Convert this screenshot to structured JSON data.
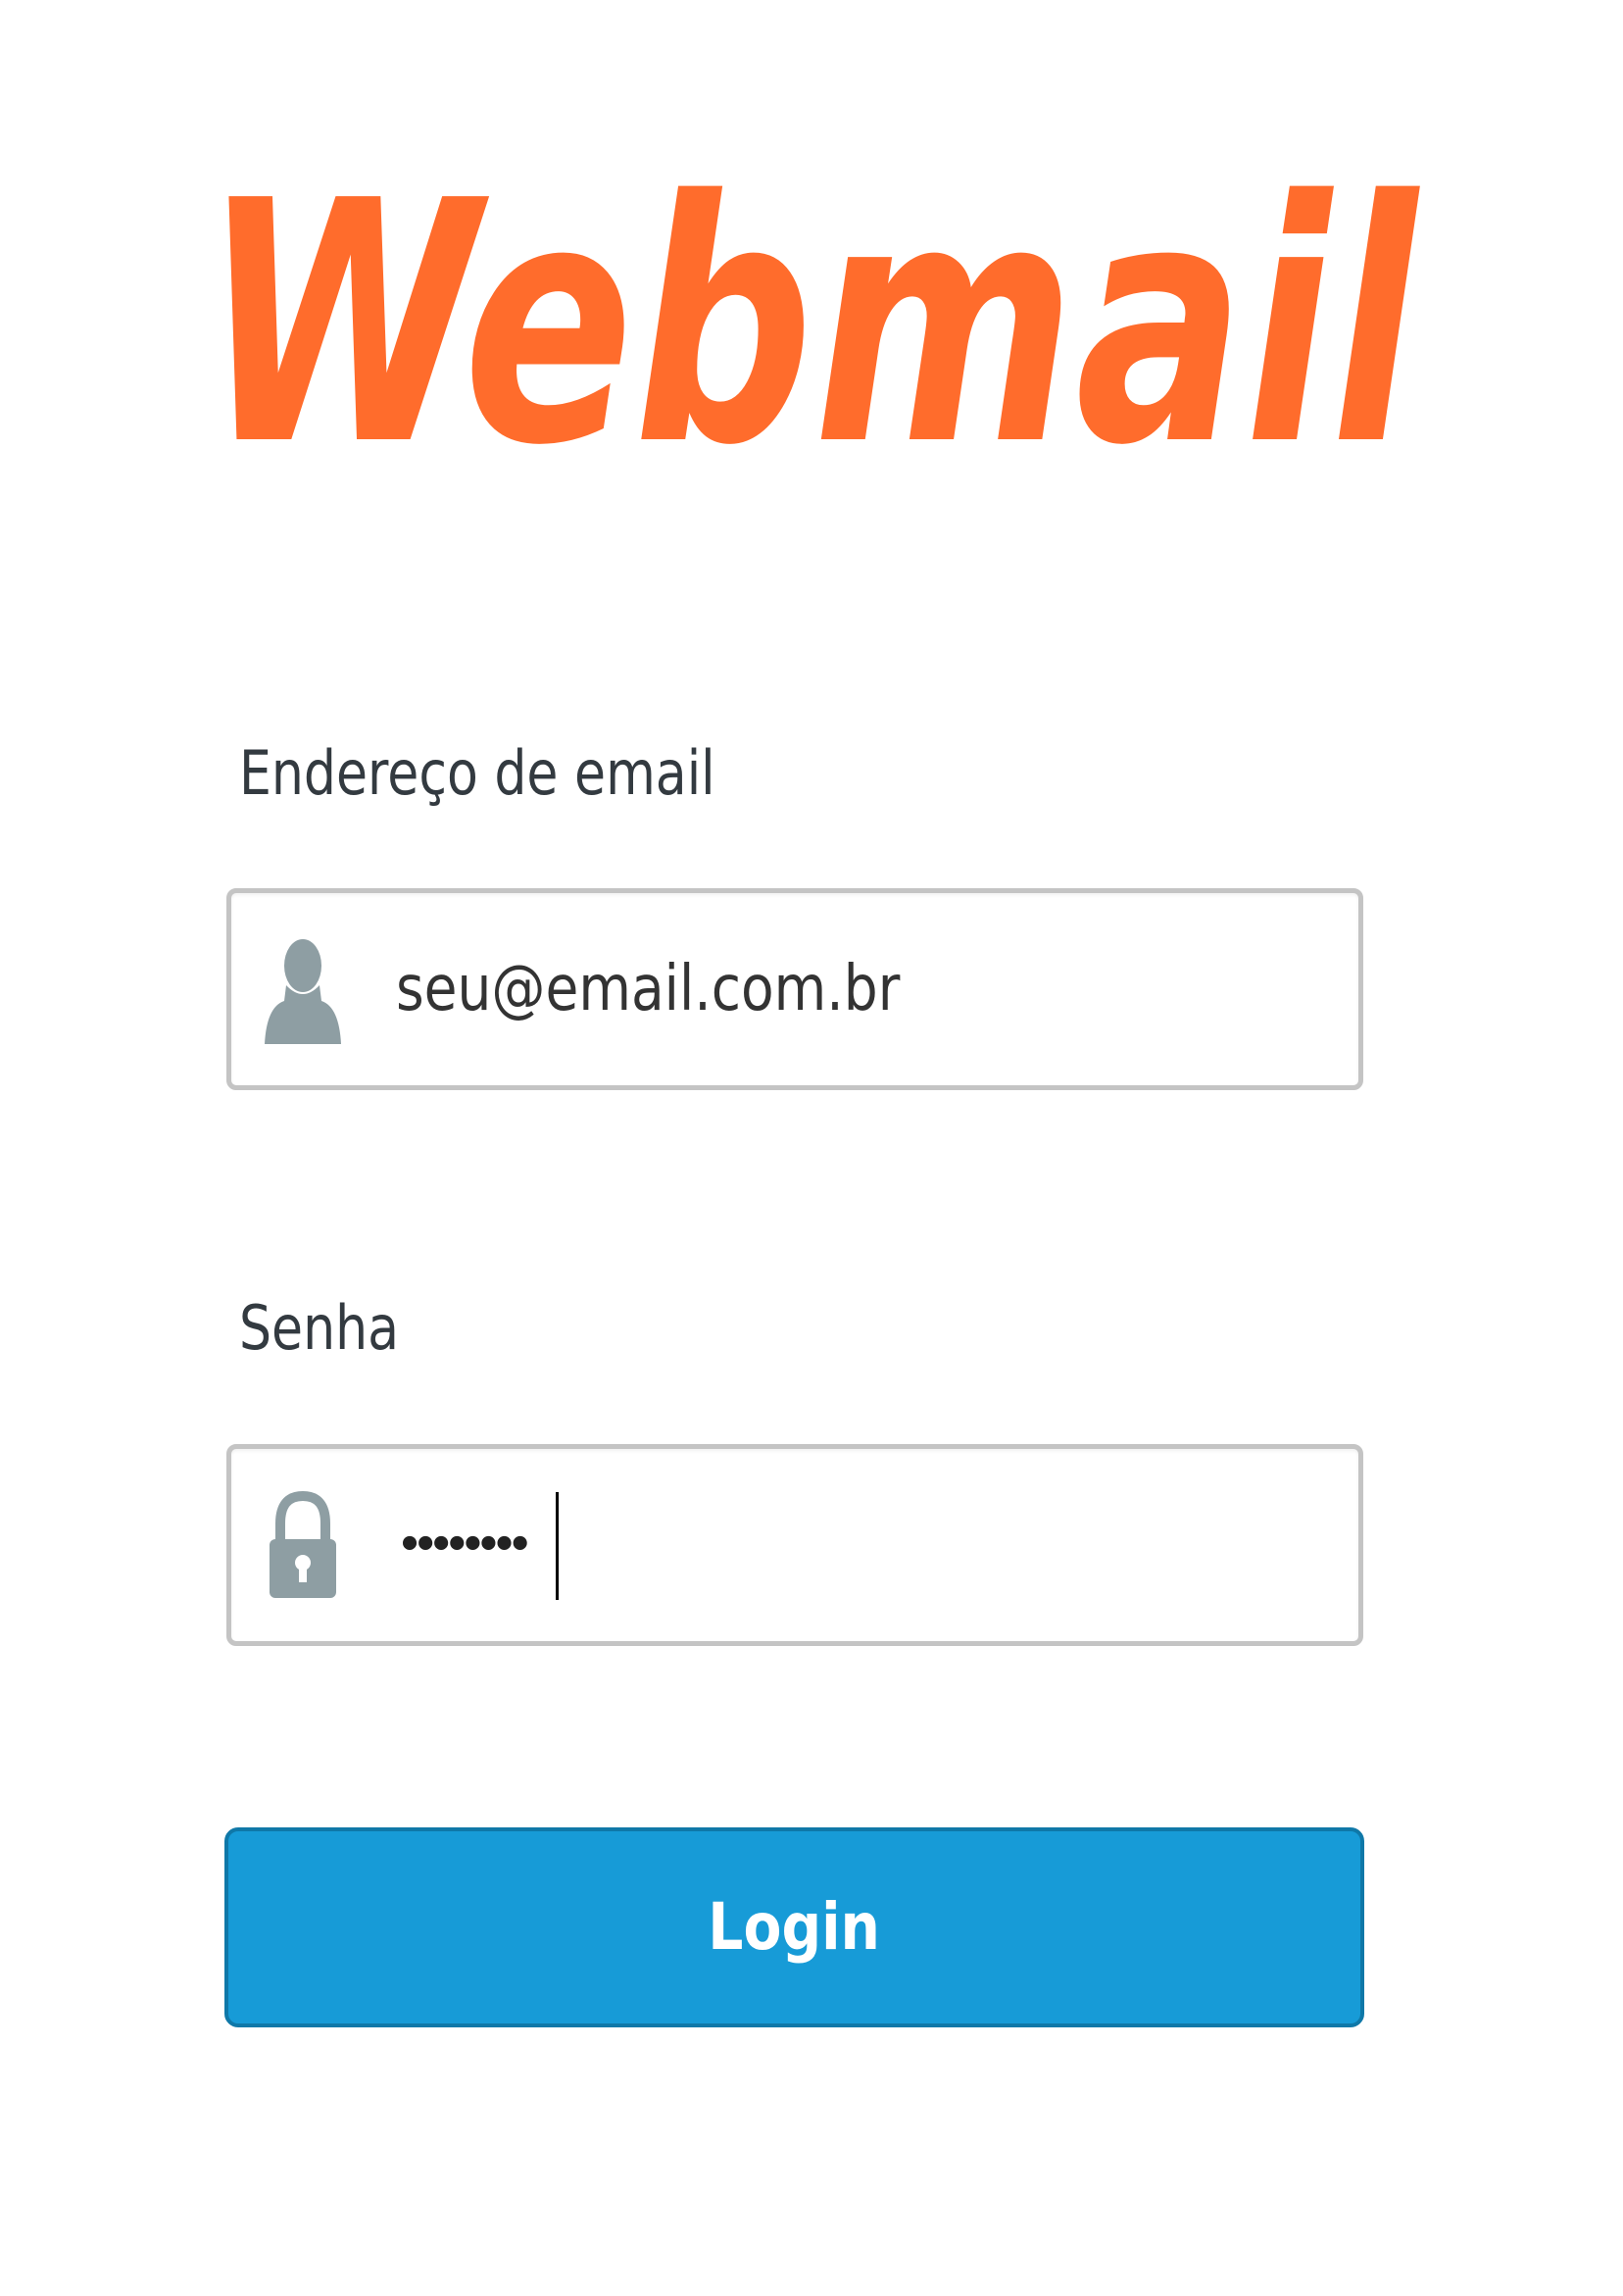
{
  "logo": {
    "text": "Webmail",
    "color": "#ff6c2c"
  },
  "form": {
    "email_label": "Endereço de email",
    "email_value": "seu@email.com.br",
    "email_icon": "user-icon",
    "password_label": "Senha",
    "password_masked": "••••••••",
    "password_icon": "lock-icon",
    "login_label": "Login"
  },
  "colors": {
    "accent": "#179bd7",
    "label_text": "#333a40",
    "icon": "#8e9ea3"
  }
}
